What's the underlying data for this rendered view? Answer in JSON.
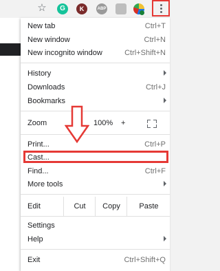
{
  "toolbar": {
    "icons": [
      "star-icon",
      "grammarly-icon",
      "k-extension-icon",
      "abp-icon",
      "hexagon-extension-icon",
      "pie-extension-icon",
      "menu-icon"
    ],
    "grammarly_letter": "G",
    "k_letter": "K",
    "abp_text": "ABP"
  },
  "menu": {
    "new_tab": {
      "label": "New tab",
      "shortcut": "Ctrl+T"
    },
    "new_window": {
      "label": "New window",
      "shortcut": "Ctrl+N"
    },
    "new_incognito": {
      "label": "New incognito window",
      "shortcut": "Ctrl+Shift+N"
    },
    "history": {
      "label": "History"
    },
    "downloads": {
      "label": "Downloads",
      "shortcut": "Ctrl+J"
    },
    "bookmarks": {
      "label": "Bookmarks"
    },
    "zoom": {
      "label": "Zoom",
      "minus": "−",
      "value": "100%",
      "plus": "+"
    },
    "print": {
      "label": "Print...",
      "shortcut": "Ctrl+P"
    },
    "cast": {
      "label": "Cast..."
    },
    "find": {
      "label": "Find...",
      "shortcut": "Ctrl+F"
    },
    "more_tools": {
      "label": "More tools"
    },
    "edit": {
      "label": "Edit",
      "cut": "Cut",
      "copy": "Copy",
      "paste": "Paste"
    },
    "settings": {
      "label": "Settings"
    },
    "help": {
      "label": "Help"
    },
    "exit": {
      "label": "Exit",
      "shortcut": "Ctrl+Shift+Q"
    }
  },
  "colors": {
    "highlight": "#e53935",
    "accent": "#1a73e8"
  }
}
